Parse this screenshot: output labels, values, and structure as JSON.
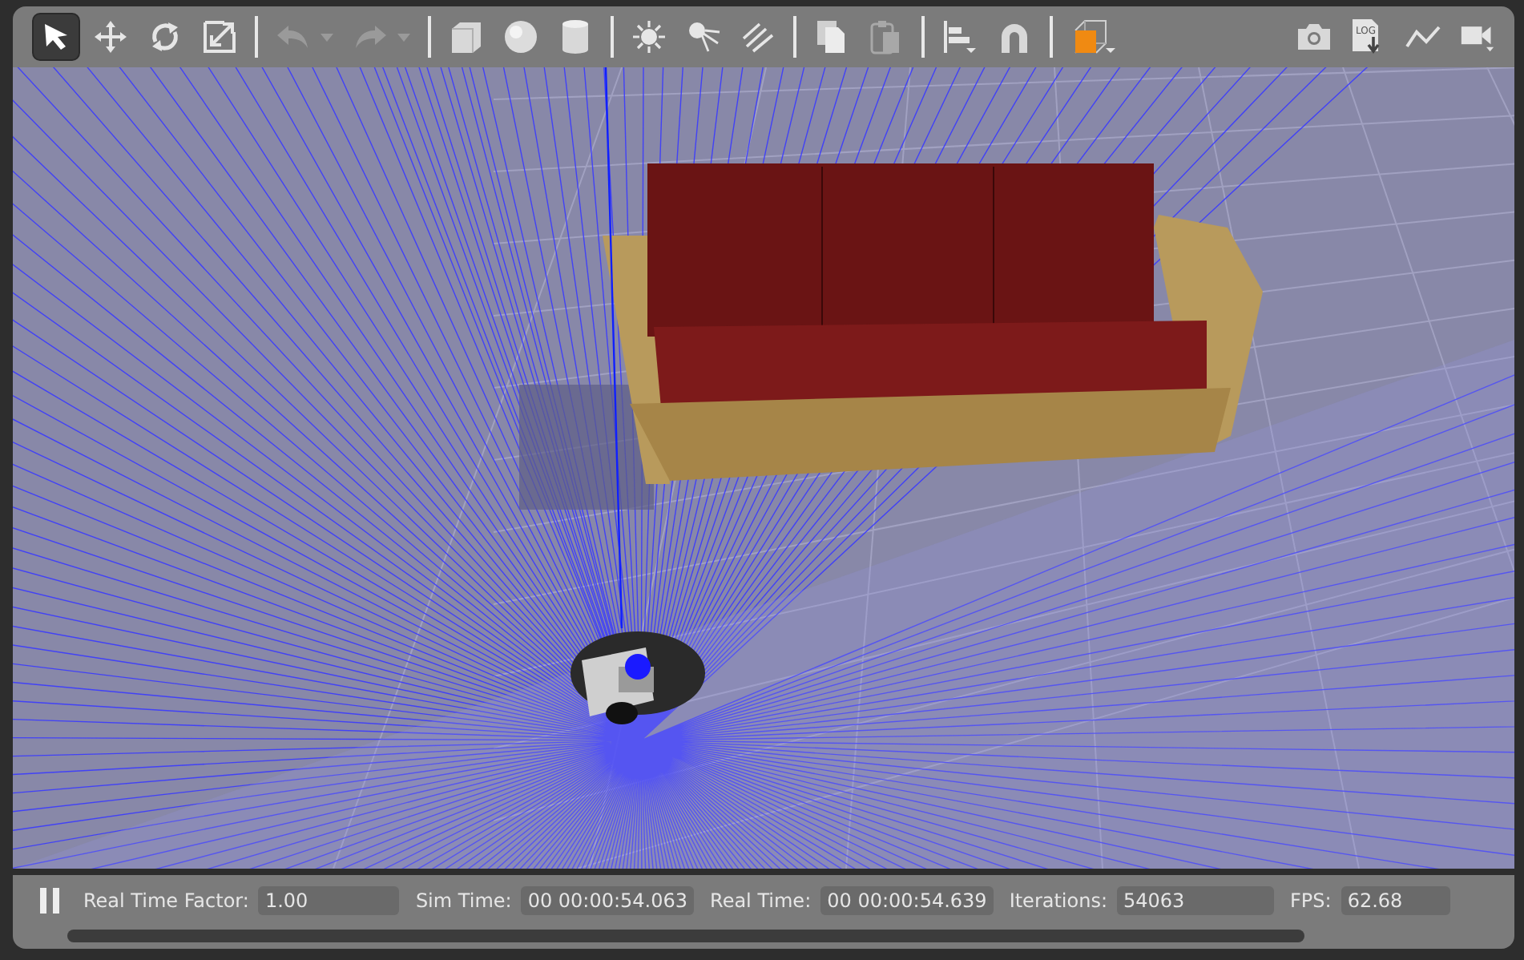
{
  "toolbar": {
    "mode_tools": [
      {
        "kind": "select",
        "selected": true
      },
      {
        "kind": "translate",
        "selected": false
      },
      {
        "kind": "rotate",
        "selected": false
      },
      {
        "kind": "scale",
        "selected": false
      }
    ],
    "history": [
      {
        "kind": "undo",
        "disabled": true
      },
      {
        "kind": "redo",
        "disabled": true
      }
    ],
    "log_icon_label": "LOG"
  },
  "status_bar": {
    "running": true,
    "fields": [
      {
        "label": "Real Time Factor:",
        "value": "1.00"
      },
      {
        "label": "Sim Time:",
        "value": "00 00:00:54.063"
      },
      {
        "label": "Real Time:",
        "value": "00 00:00:54.639"
      },
      {
        "label": "Iterations:",
        "value": "54063"
      },
      {
        "label": "FPS:",
        "value": "62.68"
      }
    ]
  }
}
